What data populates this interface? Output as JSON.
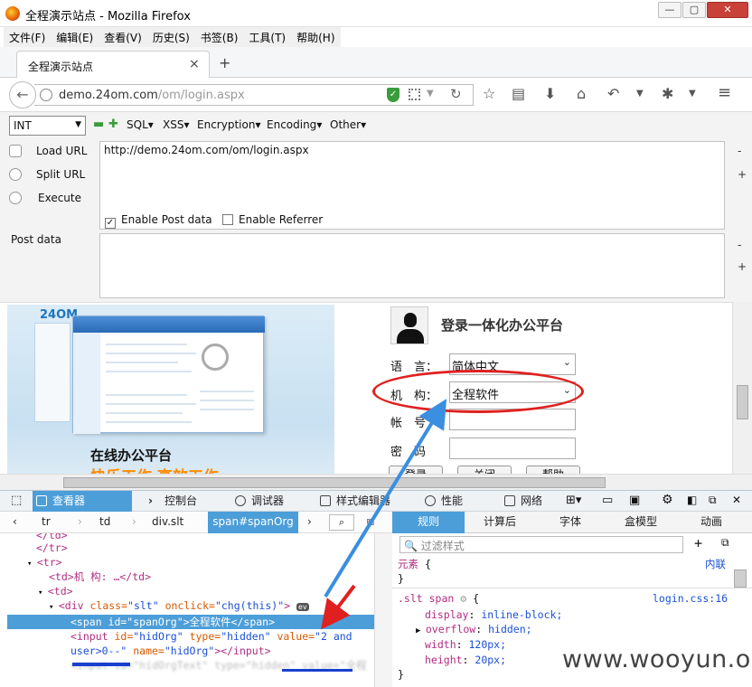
{
  "window": {
    "title": "全程演示站点 - Mozilla Firefox",
    "min": "—",
    "max": "▢",
    "close": "✕"
  },
  "menu": [
    "文件(F)",
    "编辑(E)",
    "查看(V)",
    "历史(S)",
    "书签(B)",
    "工具(T)",
    "帮助(H)"
  ],
  "tab": {
    "title": "全程演示站点",
    "close": "×",
    "new": "+"
  },
  "nav": {
    "url_host": "demo.24om.com",
    "url_path": "/om/login.aspx"
  },
  "hackbar": {
    "select": "INT",
    "menus": [
      "SQL",
      "XSS",
      "Encryption",
      "Encoding",
      "Other"
    ],
    "load_url": "Load URL",
    "split_url": "Split URL",
    "execute": "Execute",
    "url_value": "http://demo.24om.com/om/login.aspx",
    "enable_post": "Enable Post data",
    "enable_referrer": "Enable Referrer",
    "post_label": "Post data"
  },
  "page": {
    "logo": "24OM",
    "slogan": "在线办公平台",
    "slogan2": "快乐工作 高效工作",
    "login_title": "登录一体化办公平台",
    "fields": [
      {
        "label": "语　言：",
        "value": "简体中文"
      },
      {
        "label": "机　构：",
        "value": "全程软件"
      },
      {
        "label": "帐　号",
        "value": ""
      },
      {
        "label": "密　码",
        "value": ""
      }
    ],
    "buttons": [
      "登录",
      "关闭",
      "帮助"
    ]
  },
  "devtools": {
    "tabs": [
      "查看器",
      "控制台",
      "调试器",
      "样式编辑器",
      "性能",
      "网络"
    ],
    "breadcrumbs": [
      "tr",
      "td",
      "div.slt",
      "span#spanOrg"
    ],
    "rule_tabs": [
      "规则",
      "计算后",
      "字体",
      "盒模型",
      "动画"
    ],
    "filter_placeholder": "过滤样式",
    "element_label": "元素",
    "element_brace": "{",
    "inline_label": "内联",
    "close_brace": "}",
    "rule_selector": ".slt span",
    "rule_source": "login.css:16",
    "props": [
      {
        "name": "display",
        "value": "inline-block;"
      },
      {
        "name": "overflow",
        "value": "hidden;"
      },
      {
        "name": "width",
        "value": "120px;"
      },
      {
        "name": "height",
        "value": "20px;"
      }
    ]
  },
  "markup": {
    "l1": "</td>",
    "l2": "</tr>",
    "l3": "<tr>",
    "l4": "<td>机  构: …</td>",
    "l5": "<td>",
    "l6_tag": "<div ",
    "l6_a1": "class=",
    "l6_v1": "\"slt\"",
    "l6_a2": " onclick=",
    "l6_v2": "\"chg(this)\"",
    "l6_end": ">",
    "l7": "<span id=\"spanOrg\">全程软件</span>",
    "l8_tag": "<input ",
    "l8_a1": "id=",
    "l8_v1": "\"hidOrg\"",
    "l8_a2": " type=",
    "l8_v2": "\"hidden\"",
    "l8_a3": " value=",
    "l8_v3": "\"2 and",
    "l9_v": "user>0--\"",
    "l9_a": " name=",
    "l9_v2": "\"hidOrg\"",
    "l9_end": "></input>"
  },
  "watermark": "www.wooyun.org",
  "colors": {
    "accent": "#4c9ed9",
    "annotation_red": "#e02020",
    "annotation_blue": "#3a8fe0"
  }
}
